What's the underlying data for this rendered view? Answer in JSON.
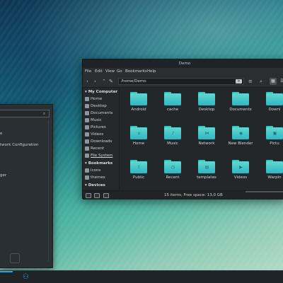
{
  "left_window": {
    "items": [
      "e",
      "twork Configuration",
      "ger"
    ]
  },
  "file_manager": {
    "title": "Demo",
    "menu": [
      "File",
      "Edit",
      "View",
      "Go",
      "Bookmarks",
      "Help"
    ],
    "path": "/home/Demo",
    "sidebar": {
      "my_computer_heading": "My Computer",
      "my_computer_items": [
        "Home",
        "Desktop",
        "Documents",
        "Music",
        "Pictures",
        "Videos",
        "Downloads",
        "Recent",
        "File System"
      ],
      "bookmarks_heading": "Bookmarks",
      "bookmarks_items": [
        "icons",
        "themes"
      ],
      "devices_heading": "Devices"
    },
    "folders": [
      {
        "label": "Android",
        "emblem": ""
      },
      {
        "label": "cache",
        "emblem": ""
      },
      {
        "label": "Desktop",
        "emblem": ""
      },
      {
        "label": "Documents",
        "emblem": ""
      },
      {
        "label": "Downl",
        "emblem": ""
      },
      {
        "label": "Home",
        "emblem": "home-icon"
      },
      {
        "label": "Music",
        "emblem": "music-icon"
      },
      {
        "label": "Network",
        "emblem": "network-icon"
      },
      {
        "label": "New Blender",
        "emblem": "blender-icon"
      },
      {
        "label": "Pictu",
        "emblem": "picture-icon"
      },
      {
        "label": "Public",
        "emblem": "share-icon"
      },
      {
        "label": "Recent",
        "emblem": "clock-icon"
      },
      {
        "label": "templates",
        "emblem": "template-icon"
      },
      {
        "label": "Videos",
        "emblem": "video-icon"
      },
      {
        "label": "Warpin",
        "emblem": ""
      }
    ],
    "status": "15 items, Free space: 13,0 GB"
  },
  "colors": {
    "folder": "#4fcfcb",
    "window_bg": "#232729",
    "accent": "#3aa0d8"
  }
}
